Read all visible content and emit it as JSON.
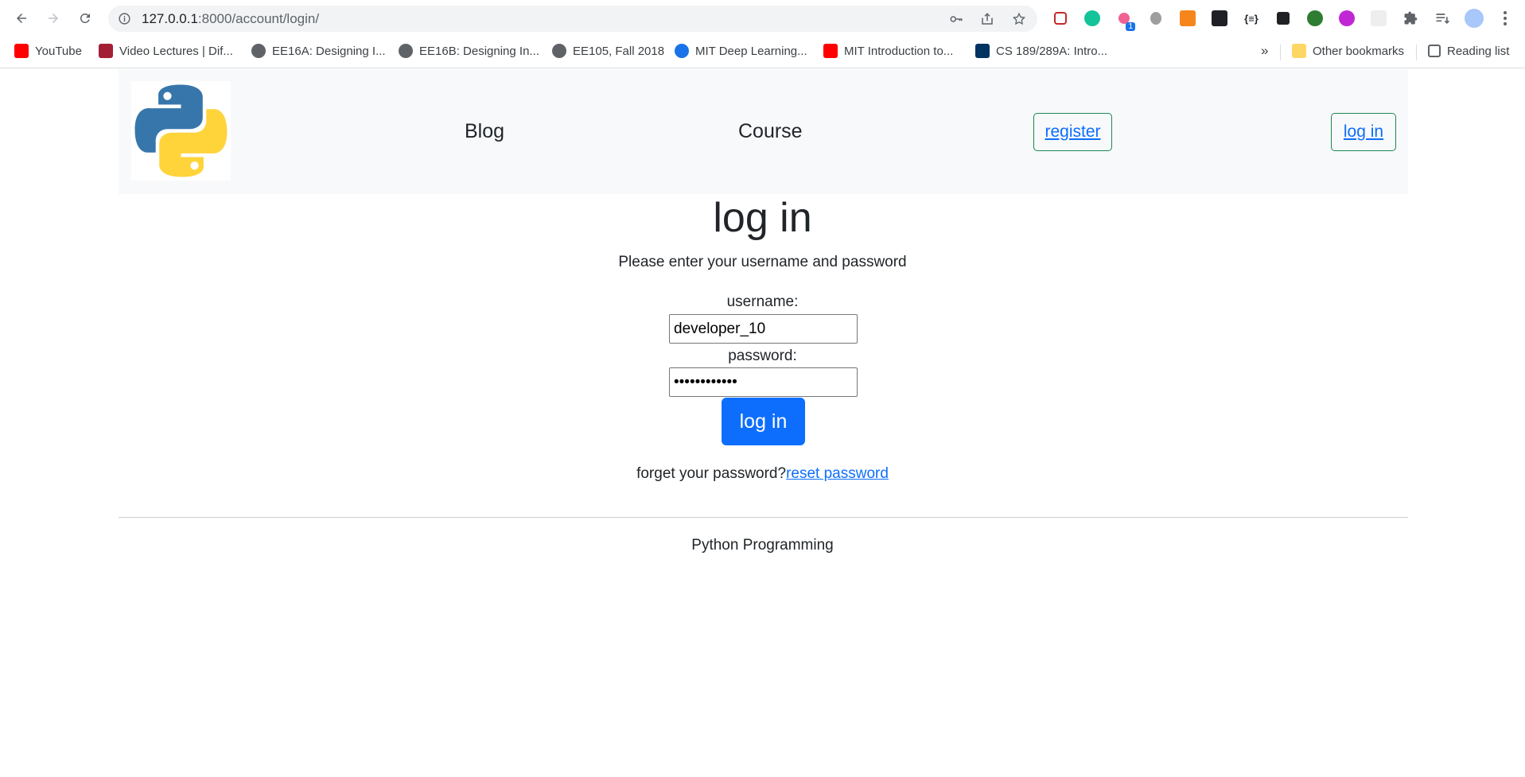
{
  "browser": {
    "url_host": "127.0.0.1",
    "url_path": ":8000/account/login/",
    "extensions": [
      "adblock-icon",
      "grammarly-icon",
      "extension-badge-icon",
      "bug-icon",
      "metamask-icon",
      "binance-icon",
      "json-icon",
      "x-icon",
      "tree-icon",
      "purple-icon",
      "blank-ext-icon",
      "puzzle-icon",
      "reading-list-icon",
      "profile-avatar"
    ],
    "extension_badge": "1",
    "bookmarks": [
      {
        "label": "YouTube",
        "icon": "youtube-icon",
        "color": "#ff0000"
      },
      {
        "label": "Video Lectures | Dif...",
        "icon": "mit-ocw-icon",
        "color": "#a31f34"
      },
      {
        "label": "EE16A: Designing I...",
        "icon": "globe-icon",
        "color": "#5f6368"
      },
      {
        "label": "EE16B: Designing In...",
        "icon": "globe-icon",
        "color": "#5f6368"
      },
      {
        "label": "EE105, Fall 2018",
        "icon": "globe-icon",
        "color": "#5f6368"
      },
      {
        "label": "MIT Deep Learning...",
        "icon": "network-icon",
        "color": "#1a73e8"
      },
      {
        "label": "MIT Introduction to...",
        "icon": "youtube-icon",
        "color": "#ff0000"
      },
      {
        "label": "CS 189/289A: Intro...",
        "icon": "berkeley-icon",
        "color": "#003262"
      }
    ],
    "overflow": "»",
    "other_bookmarks": "Other bookmarks",
    "reading_list": "Reading list"
  },
  "header": {
    "nav": {
      "blog": "Blog",
      "course": "Course"
    },
    "register": "register",
    "login": "log in"
  },
  "main": {
    "title": "log in",
    "subtitle": "Please enter your username and password",
    "username_label": "username:",
    "username_value": "developer_10",
    "password_label": "password:",
    "password_value": "••••••••••••",
    "submit": "log in",
    "forgot_text": "forget your password?",
    "reset_link": "reset password"
  },
  "footer": {
    "text": "Python Programming"
  },
  "colors": {
    "primary": "#0d6efd",
    "outline": "#198754",
    "header_bg": "#f8f9fa"
  }
}
